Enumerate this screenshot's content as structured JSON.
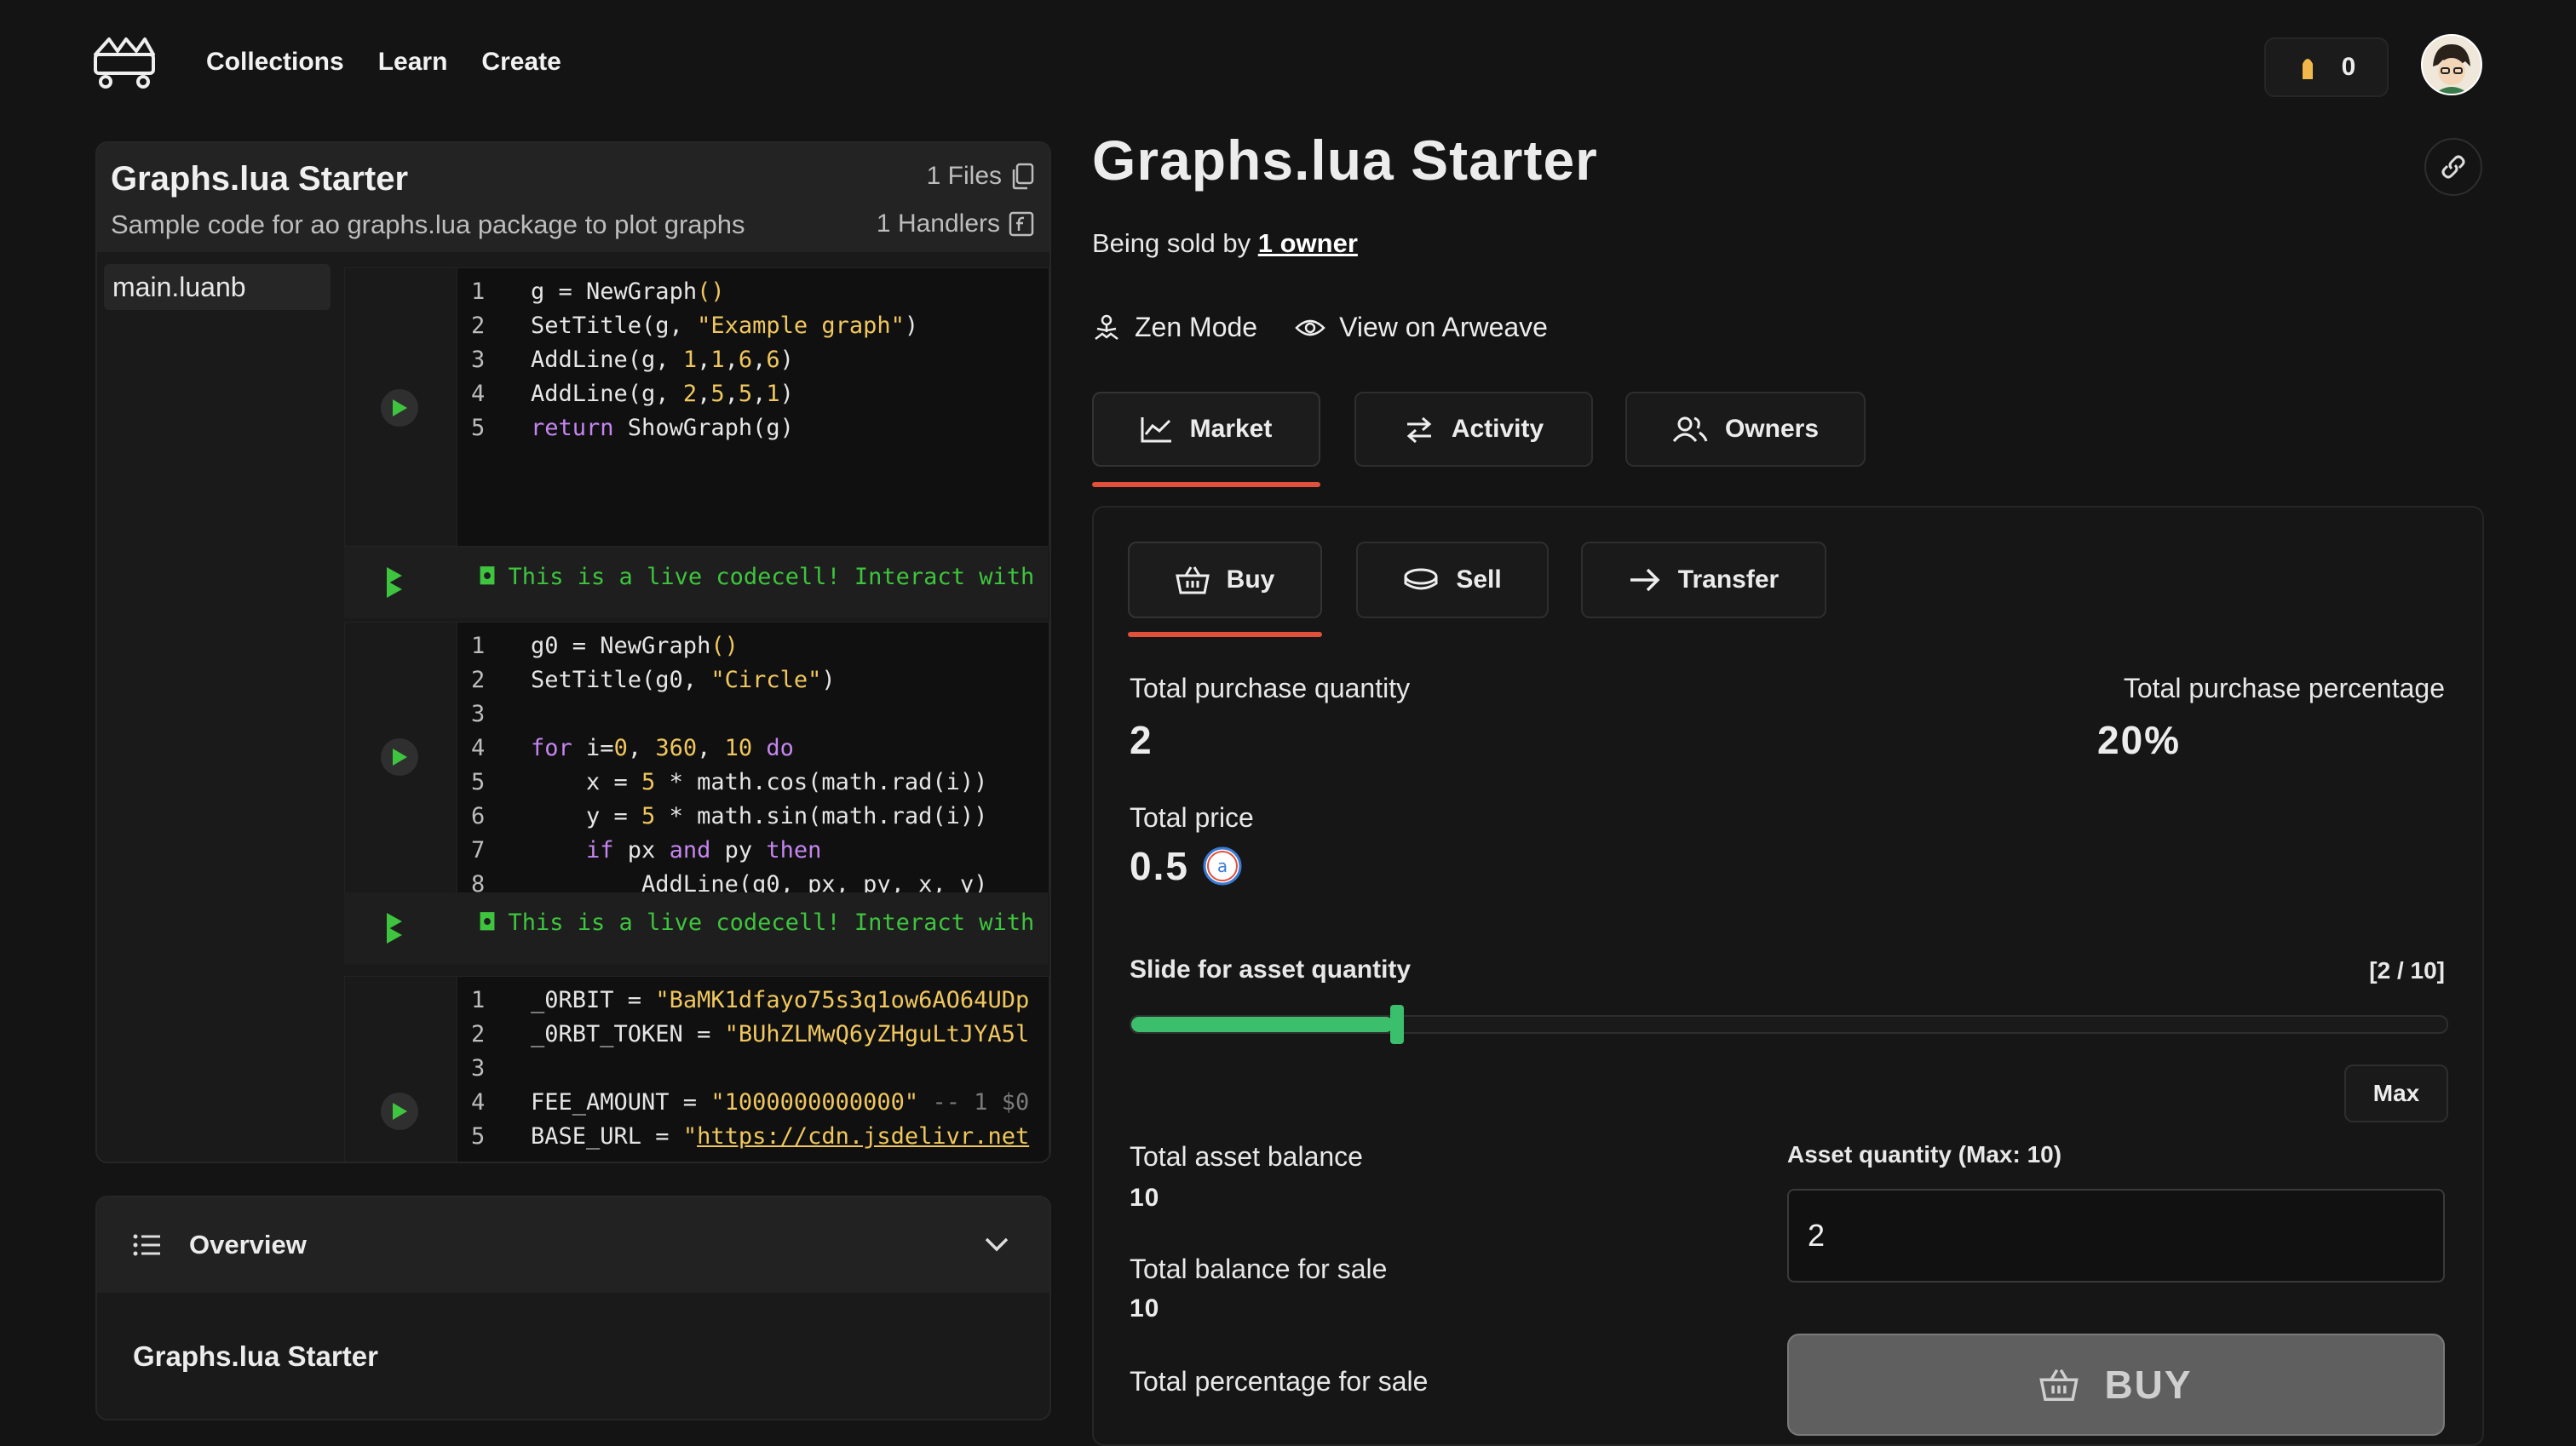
{
  "nav": {
    "links": [
      "Collections",
      "Learn",
      "Create"
    ],
    "credits_value": "0"
  },
  "notebook": {
    "title": "Graphs.lua Starter",
    "description": "Sample code for ao graphs.lua package to plot graphs",
    "files_label": "1 Files",
    "handlers_label": "1 Handlers",
    "file_tab": "main.luanb",
    "output_text": "This is a live codecell! Interact with",
    "cell1_lines": [
      "1",
      "2",
      "3",
      "4",
      "5"
    ],
    "cell2_lines": [
      "1",
      "2",
      "3",
      "4",
      "5",
      "6",
      "7",
      "8"
    ],
    "cell3_lines": [
      "1",
      "2",
      "3",
      "4",
      "5"
    ]
  },
  "overview": {
    "title": "Overview",
    "subtitle": "Graphs.lua Starter"
  },
  "asset": {
    "title": "Graphs.lua Starter",
    "sold_by_prefix": "Being sold by",
    "sold_by_link": "1 owner",
    "zen_mode": "Zen Mode",
    "view_arweave": "View on Arweave"
  },
  "tabs": {
    "market": "Market",
    "activity": "Activity",
    "owners": "Owners"
  },
  "trade_tabs": {
    "buy": "Buy",
    "sell": "Sell",
    "transfer": "Transfer"
  },
  "market": {
    "total_purchase_quantity_label": "Total purchase quantity",
    "total_purchase_quantity": "2",
    "total_purchase_percentage_label": "Total purchase percentage",
    "total_purchase_percentage": "20%",
    "total_price_label": "Total price",
    "total_price": "0.5",
    "slider_label": "Slide for asset quantity",
    "slider_readout": "[2 / 10]",
    "slider_fraction": 0.2,
    "max_button": "Max",
    "total_asset_balance_label": "Total asset balance",
    "total_asset_balance": "10",
    "total_balance_sale_label": "Total balance for sale",
    "total_balance_sale": "10",
    "total_percentage_sale_label": "Total percentage for sale",
    "asset_quantity_label": "Asset quantity (Max: 10)",
    "asset_quantity_value": "2",
    "buy_button": "BUY"
  },
  "colors": {
    "accent_underline": "#e0503a",
    "slider_green": "#3cbf6c",
    "output_green": "#3ec43e"
  }
}
